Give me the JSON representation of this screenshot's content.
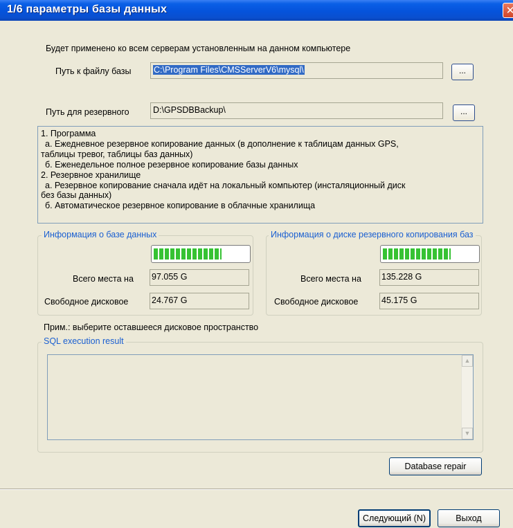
{
  "window": {
    "title": "1/6  параметры базы данных",
    "close": "✕"
  },
  "notice": "Будет применено ко всем серверам установленным на данном компьютере",
  "db_path": {
    "label": "Путь к файлу базы",
    "value": "C:\\Program Files\\CMSServerV6\\mysql\\",
    "browse": "..."
  },
  "backup_path": {
    "label": "Путь для резервного",
    "value": "D:\\GPSDBBackup\\",
    "browse": "..."
  },
  "info_lines": [
    "1. Программа",
    "  а. Ежедневное резервное копирование данных (в дополнение к таблицам данных GPS,",
    "таблицы тревог, таблицы баз данных)",
    "  б. Еженедельное полное резервное копирование базы данных",
    "2. Резервное хранилище",
    "  а. Резервное копирование сначала идёт на локальный компьютер (инсталяционный диск",
    "без базы данных)",
    "  б. Автоматическое резервное копирование в облачные хранилища"
  ],
  "db_info": {
    "title": "Информация о базе данных",
    "usage_fraction": 0.72,
    "total_label": "Всего места на",
    "total_value": "97.055 G",
    "free_label": "Свободное дисковое",
    "free_value": "24.767 G"
  },
  "backup_info": {
    "title": "Информация о диске резервного копирования баз",
    "usage_fraction": 0.72,
    "total_label": "Всего места на",
    "total_value": "135.228 G",
    "free_label": "Свободное дисковое",
    "free_value": "45.175 G"
  },
  "note": "Прим.: выберите оставшееся дисковое пространство",
  "sql": {
    "title": "SQL execution result",
    "content": "",
    "scroll_up": "▲",
    "scroll_down": "▼"
  },
  "buttons": {
    "repair": "Database repair",
    "next": "Следующий (N)",
    "exit": "Выход"
  },
  "colors": {
    "titlebar": "#0553db",
    "group_title": "#1a5fd1",
    "progress_fill": "#36c233",
    "selection": "#316ac5"
  }
}
